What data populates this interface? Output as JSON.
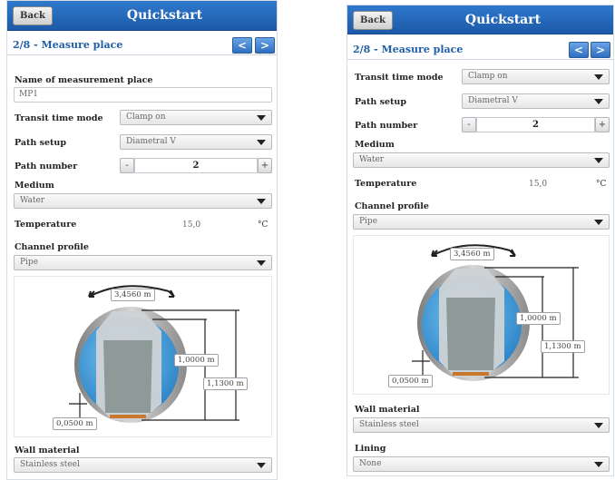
{
  "left_screen": {
    "header": {
      "back_label": "Back",
      "title": "Quickstart"
    },
    "step": {
      "title": "2/8 - Measure place",
      "prev_label": "<",
      "next_label": ">"
    },
    "name_place": {
      "label": "Name of measurement place",
      "value": "MP1"
    },
    "transit_time_mode": {
      "label": "Transit time mode",
      "value": "Clamp on"
    },
    "path_setup": {
      "label": "Path setup",
      "value": "Diametral V"
    },
    "path_number": {
      "label": "Path number",
      "minus": "-",
      "value": "2",
      "plus": "+"
    },
    "medium": {
      "label": "Medium",
      "value": "Water"
    },
    "temperature": {
      "label": "Temperature",
      "value": "15,0",
      "unit": "°C"
    },
    "channel_profile": {
      "label": "Channel profile",
      "value": "Pipe"
    },
    "diagram": {
      "circumference": "3,4560",
      "circumference_unit": "m",
      "height_a": "1,0000",
      "height_a_unit": "m",
      "height_b": "1,1300",
      "height_b_unit": "m",
      "wall": "0,0500",
      "wall_unit": "m"
    },
    "wall_material": {
      "label": "Wall material",
      "value": "Stainless steel"
    }
  },
  "right_screen": {
    "header": {
      "back_label": "Back",
      "title": "Quickstart"
    },
    "step": {
      "title": "2/8 - Measure place",
      "prev_label": "<",
      "next_label": ">"
    },
    "transit_time_mode": {
      "label": "Transit time mode",
      "value": "Clamp on"
    },
    "path_setup": {
      "label": "Path setup",
      "value": "Diametral V"
    },
    "path_number": {
      "label": "Path number",
      "minus": "-",
      "value": "2",
      "plus": "+"
    },
    "medium": {
      "label": "Medium",
      "value": "Water"
    },
    "temperature": {
      "label": "Temperature",
      "value": "15,0",
      "unit": "°C"
    },
    "channel_profile": {
      "label": "Channel profile",
      "value": "Pipe"
    },
    "diagram": {
      "circumference": "3,4560",
      "circumference_unit": "m",
      "height_a": "1,0000",
      "height_a_unit": "m",
      "height_b": "1,1300",
      "height_b_unit": "m",
      "wall": "0,0500",
      "wall_unit": "m"
    },
    "wall_material": {
      "label": "Wall material",
      "value": "Stainless steel"
    },
    "lining": {
      "label": "Lining",
      "value": "None"
    }
  },
  "colors": {
    "header_blue": "#2f79cc",
    "accent_blue": "#1f5ea8",
    "water_blue": "#4aa6e4",
    "pipe_gray": "#9a9a9a",
    "sediment_orange": "#c8782a"
  },
  "icons": {
    "dropdown": "chevron-down-icon",
    "rotate_arrows": "circumference-arrow-icon",
    "dimension_lines": "dimension-arrow-icon"
  }
}
